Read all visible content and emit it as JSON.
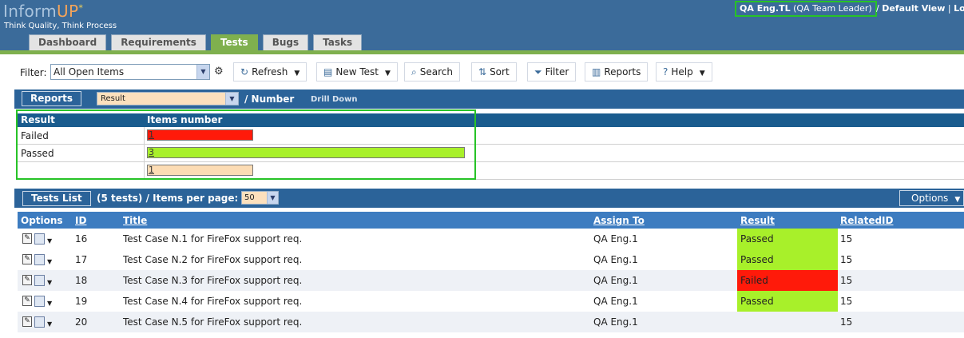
{
  "header": {
    "logo": {
      "inform": "Inform",
      "up": "UP",
      "star": "*"
    },
    "slogan": "Think Quality, Think Process",
    "user": {
      "name": "QA Eng.TL",
      "role": "(QA Team Leader)",
      "separator": "/",
      "view": "Default View",
      "pipe": "|",
      "logout": "Lo"
    },
    "tabs": [
      {
        "label": "Dashboard",
        "active": false
      },
      {
        "label": "Requirements",
        "active": false
      },
      {
        "label": "Tests",
        "active": true
      },
      {
        "label": "Bugs",
        "active": false
      },
      {
        "label": "Tasks",
        "active": false
      }
    ]
  },
  "toolbar": {
    "filter_label": "Filter:",
    "filter_value": "All Open Items",
    "buttons": {
      "refresh": "Refresh",
      "new_test": "New Test",
      "search": "Search",
      "sort": "Sort",
      "filter": "Filter",
      "reports": "Reports",
      "help": "Help"
    }
  },
  "reports": {
    "button": "Reports",
    "group_by": "Result",
    "separator_text": "/ Number",
    "drill_down": "Drill Down",
    "columns": [
      "Result",
      "Items number"
    ],
    "rows": [
      {
        "label": "Failed",
        "count": "1",
        "fraction": 0.333,
        "color": "#ff1a0a"
      },
      {
        "label": "Passed",
        "count": "3",
        "fraction": 1.0,
        "color": "#a8f02a"
      },
      {
        "label": "",
        "count": "1",
        "fraction": 0.333,
        "color": "#fcdcb4"
      }
    ]
  },
  "tests_list": {
    "button": "Tests List",
    "summary": "(5 tests) / Items per page:",
    "items_per_page": "50",
    "options": "Options",
    "columns": {
      "options": "Options",
      "id": "ID",
      "title": "Title",
      "assign_to": "Assign To",
      "result": "Result",
      "related_id": "RelatedID"
    },
    "rows": [
      {
        "id": "16",
        "title": "Test Case N.1 for FireFox support req.",
        "assign_to": "QA Eng.1",
        "result": "Passed",
        "result_color": "#a8f02a",
        "related_id": "15"
      },
      {
        "id": "17",
        "title": "Test Case N.2 for FireFox support req.",
        "assign_to": "QA Eng.1",
        "result": "Passed",
        "result_color": "#a8f02a",
        "related_id": "15"
      },
      {
        "id": "18",
        "title": "Test Case N.3 for FireFox support req.",
        "assign_to": "QA Eng.1",
        "result": "Failed",
        "result_color": "#ff1a0a",
        "related_id": "15"
      },
      {
        "id": "19",
        "title": "Test Case N.4 for FireFox support req.",
        "assign_to": "QA Eng.1",
        "result": "Passed",
        "result_color": "#a8f02a",
        "related_id": "15"
      },
      {
        "id": "20",
        "title": "Test Case N.5 for FireFox support req.",
        "assign_to": "QA Eng.1",
        "result": "",
        "result_color": "",
        "related_id": "15"
      }
    ]
  },
  "colors": {
    "header_bg": "#3b6b9a",
    "accent_green": "#7fb04e",
    "table_header": "#1a5c8e",
    "highlight": "#27c327"
  }
}
